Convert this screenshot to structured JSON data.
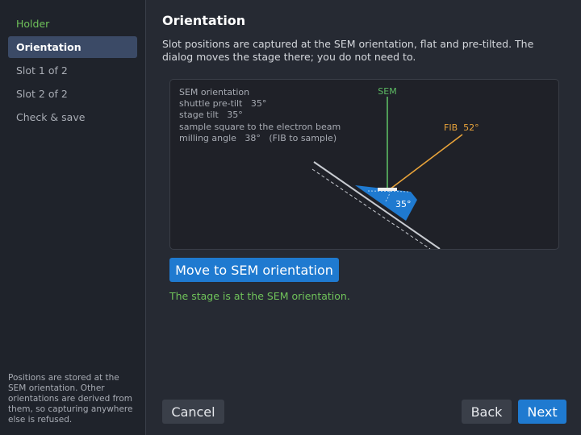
{
  "sidebar": {
    "items": [
      {
        "label": "Holder",
        "state": "done"
      },
      {
        "label": "Orientation",
        "state": "active"
      },
      {
        "label": "Slot 1 of 2",
        "state": "pending"
      },
      {
        "label": "Slot 2 of 2",
        "state": "pending"
      },
      {
        "label": "Check & save",
        "state": "pending"
      }
    ],
    "note": "Positions are stored at the SEM orientation. Other orientations are derived from them, so capturing anywhere else is refused."
  },
  "main": {
    "title": "Orientation",
    "description": "Slot positions are captured at the SEM orientation, flat and pre-tilted. The dialog moves the stage there; you do not need to.",
    "diagram": {
      "info_lines": [
        "SEM orientation",
        "shuttle pre-tilt   35°",
        "stage tilt   35°",
        "sample square to the electron beam",
        "milling angle   38°   (FIB to sample)"
      ],
      "sem_label": "SEM",
      "fib_label": "FIB  52°",
      "tilt_label": "35°",
      "colors": {
        "sem": "#5dbb63",
        "fib": "#e8a33a",
        "shuttle": "#1f7ad0",
        "stage": "#c9ccd2"
      }
    },
    "move_button_label": "Move to SEM orientation",
    "status_text": "The stage is at the SEM orientation."
  },
  "footer": {
    "cancel_label": "Cancel",
    "back_label": "Back",
    "next_label": "Next"
  },
  "colors": {
    "accent": "#1f7ad0",
    "success": "#6fc25a",
    "active_item": "#3b4a66"
  }
}
